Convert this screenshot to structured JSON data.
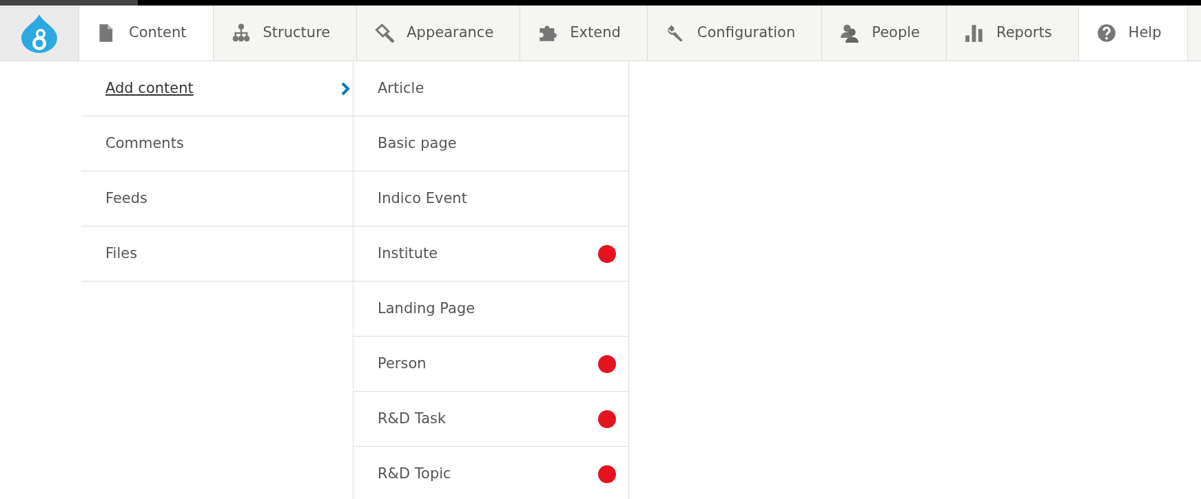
{
  "toolbar": {
    "tabs": [
      {
        "label": "Content",
        "selected": true
      },
      {
        "label": "Structure",
        "selected": false
      },
      {
        "label": "Appearance",
        "selected": false
      },
      {
        "label": "Extend",
        "selected": false
      },
      {
        "label": "Configuration",
        "selected": false
      },
      {
        "label": "People",
        "selected": false
      },
      {
        "label": "Reports",
        "selected": false
      },
      {
        "label": "Help",
        "selected": true
      }
    ]
  },
  "menu": {
    "items": [
      {
        "label": "Add content",
        "expanded": true
      },
      {
        "label": "Comments",
        "expanded": false
      },
      {
        "label": "Feeds",
        "expanded": false
      },
      {
        "label": "Files",
        "expanded": false
      }
    ]
  },
  "submenu": {
    "items": [
      {
        "label": "Article",
        "flagged": false
      },
      {
        "label": "Basic page",
        "flagged": false
      },
      {
        "label": "Indico Event",
        "flagged": false
      },
      {
        "label": "Institute",
        "flagged": true
      },
      {
        "label": "Landing Page",
        "flagged": false
      },
      {
        "label": "Person",
        "flagged": true
      },
      {
        "label": "R&D Task",
        "flagged": true
      },
      {
        "label": "R&D Topic",
        "flagged": true
      }
    ]
  }
}
